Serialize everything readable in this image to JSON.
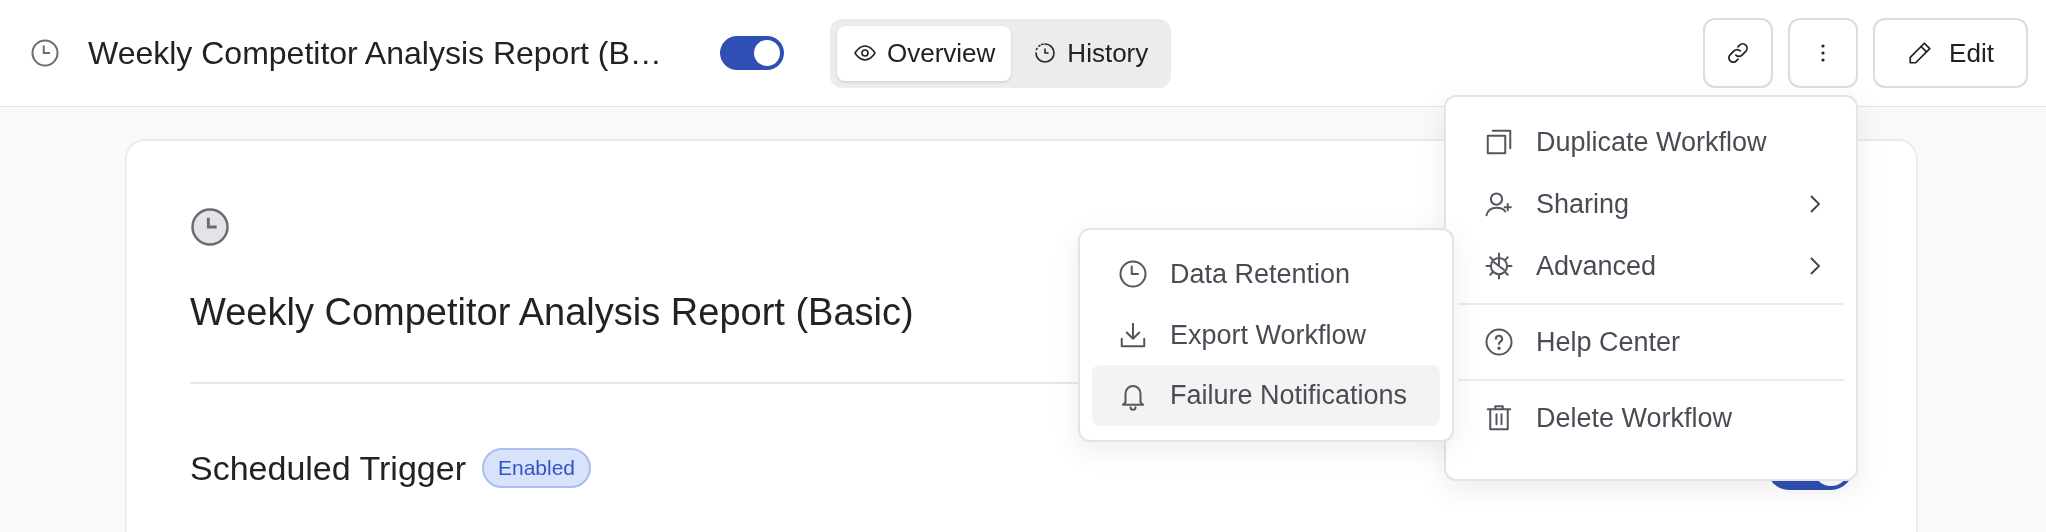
{
  "header": {
    "title": "Weekly Competitor Analysis Report (B…",
    "toggle_on": true,
    "tabs": [
      {
        "kind": "eye",
        "label": "Overview",
        "selected": true
      },
      {
        "kind": "history",
        "label": "History",
        "selected": false
      }
    ],
    "actions": [
      {
        "kind": "link"
      },
      {
        "kind": "more"
      },
      {
        "kind": "edit",
        "label": "Edit"
      }
    ]
  },
  "card": {
    "title": "Weekly Competitor Analysis Report (Basic)",
    "trigger": {
      "label": "Scheduled Trigger",
      "badge": "Enabled",
      "toggle_on": true
    }
  },
  "menu": {
    "items": [
      {
        "kind": "duplicate",
        "label": "Duplicate Workflow",
        "submenu": false,
        "divider_before": false
      },
      {
        "kind": "sharing",
        "label": "Sharing",
        "submenu": true,
        "divider_before": false
      },
      {
        "kind": "advanced",
        "label": "Advanced",
        "submenu": true,
        "divider_before": false
      },
      {
        "kind": "help",
        "label": "Help Center",
        "submenu": false,
        "divider_before": true
      },
      {
        "kind": "delete",
        "label": "Delete Workflow",
        "submenu": false,
        "divider_before": true
      }
    ]
  },
  "submenu": {
    "items": [
      {
        "kind": "retention",
        "label": "Data Retention",
        "highlighted": false
      },
      {
        "kind": "export",
        "label": "Export Workflow",
        "highlighted": false
      },
      {
        "kind": "notifications",
        "label": "Failure Notifications",
        "highlighted": true
      }
    ]
  }
}
